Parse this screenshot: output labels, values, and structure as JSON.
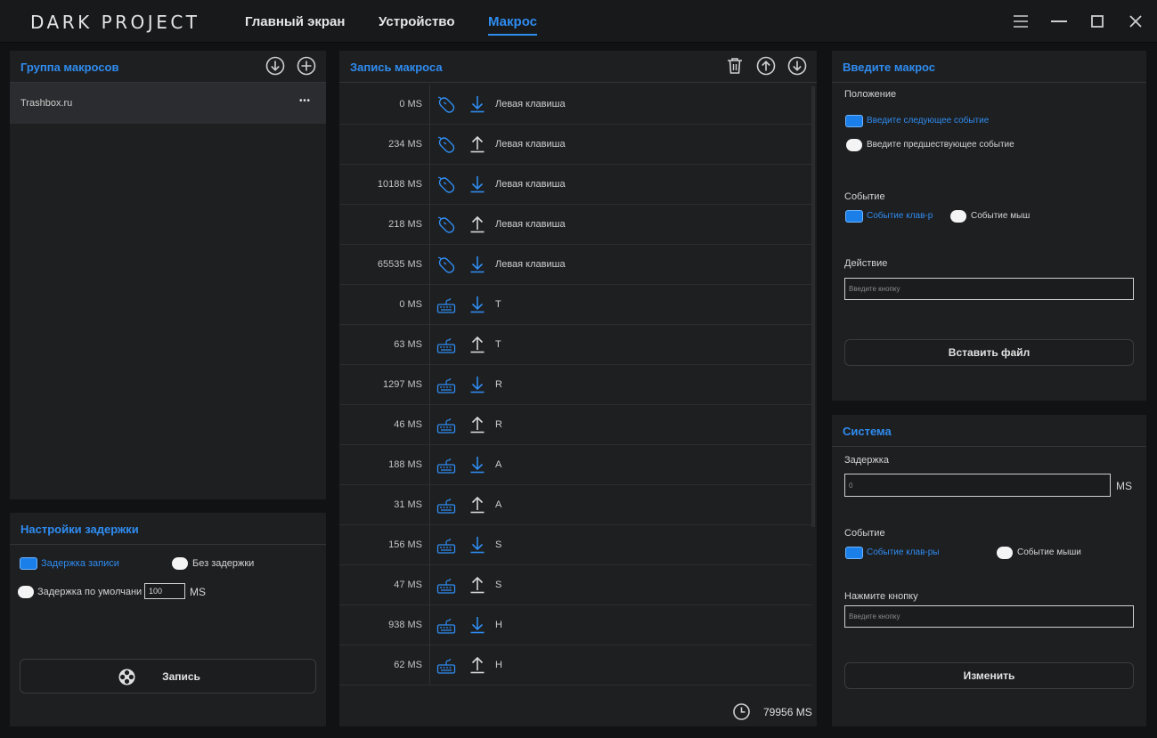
{
  "app": {
    "logo": "DARK PROJECT",
    "nav": [
      "Главный экран",
      "Устройство",
      "Макрос"
    ]
  },
  "macro_group": {
    "title": "Группа макросов",
    "item": "Trashbox.ru",
    "item_menu": "• • •"
  },
  "delay_settings": {
    "title": "Настройки задержки",
    "record_delay": "Задержка записи",
    "no_delay": "Без задержки",
    "default_delay": "Задержка по умолчани",
    "default_value": "100",
    "unit": "MS",
    "record_button": "Запись"
  },
  "macro_record": {
    "title": "Запись макроса",
    "rows": [
      {
        "time": "0 MS",
        "device": "mouse",
        "dir": "down",
        "label": "Левая клавиша"
      },
      {
        "time": "234 MS",
        "device": "mouse",
        "dir": "up",
        "label": "Левая клавиша"
      },
      {
        "time": "10188 MS",
        "device": "mouse",
        "dir": "down",
        "label": "Левая клавиша"
      },
      {
        "time": "218 MS",
        "device": "mouse",
        "dir": "up",
        "label": "Левая клавиша"
      },
      {
        "time": "65535 MS",
        "device": "mouse",
        "dir": "down",
        "label": "Левая клавиша"
      },
      {
        "time": "0 MS",
        "device": "keyboard",
        "dir": "down",
        "label": "T"
      },
      {
        "time": "63 MS",
        "device": "keyboard",
        "dir": "up",
        "label": "T"
      },
      {
        "time": "1297 MS",
        "device": "keyboard",
        "dir": "down",
        "label": "R"
      },
      {
        "time": "46 MS",
        "device": "keyboard",
        "dir": "up",
        "label": "R"
      },
      {
        "time": "188 MS",
        "device": "keyboard",
        "dir": "down",
        "label": "A"
      },
      {
        "time": "31 MS",
        "device": "keyboard",
        "dir": "up",
        "label": "A"
      },
      {
        "time": "156 MS",
        "device": "keyboard",
        "dir": "down",
        "label": "S"
      },
      {
        "time": "47 MS",
        "device": "keyboard",
        "dir": "up",
        "label": "S"
      },
      {
        "time": "938 MS",
        "device": "keyboard",
        "dir": "down",
        "label": "H"
      },
      {
        "time": "62 MS",
        "device": "keyboard",
        "dir": "up",
        "label": "H"
      }
    ],
    "total": "79956 MS"
  },
  "enter_macro": {
    "title": "Введите макрос",
    "position_label": "Положение",
    "next_event": "Введите следующее событие",
    "prev_event": "Введите предшествующее событие",
    "event_label": "Событие",
    "key_event": "Событие клав-р",
    "mouse_event": "Событие мыш",
    "action_label": "Действие",
    "action_placeholder": "Введите кнопку",
    "insert_file": "Вставить файл"
  },
  "system": {
    "title": "Система",
    "delay_label": "Задержка",
    "delay_value": "0",
    "unit": "MS",
    "event_label": "Событие",
    "key_event": "Событие клав-ры",
    "mouse_event": "Событие мыши",
    "press_label": "Нажмите кнопку",
    "press_placeholder": "Введите кнопку",
    "change_button": "Изменить"
  },
  "colors": {
    "accent": "#2f8cf0",
    "background": "#111214",
    "panel": "#1e1f21"
  }
}
